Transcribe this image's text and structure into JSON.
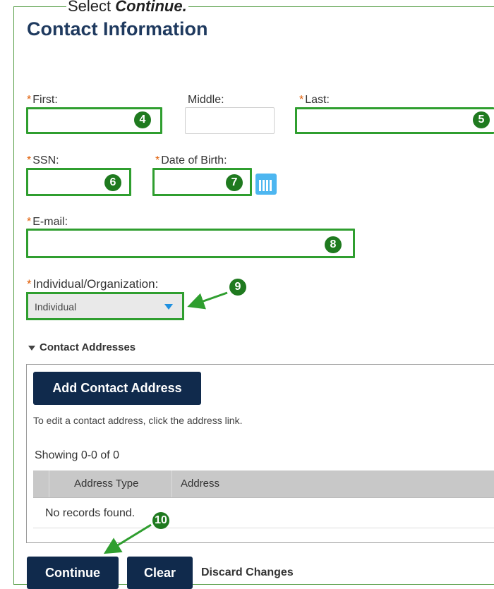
{
  "instruction": {
    "prefix": "Select ",
    "emphasis": "Continue."
  },
  "page_title": "Contact Information",
  "form": {
    "first": {
      "label": "First:",
      "required": "*",
      "value": "",
      "step": "4"
    },
    "middle": {
      "label": "Middle:",
      "value": ""
    },
    "last": {
      "label": "Last:",
      "required": "*",
      "value": "",
      "step": "5"
    },
    "ssn": {
      "label": "SSN:",
      "required": "*",
      "value": "",
      "step": "6"
    },
    "dob": {
      "label": "Date of Birth:",
      "required": "*",
      "value": "",
      "step": "7"
    },
    "email": {
      "label": "E-mail:",
      "required": "*",
      "value": "",
      "step": "8"
    },
    "type": {
      "label": "Individual/Organization:",
      "required": "*",
      "selected": "Individual",
      "step": "9"
    }
  },
  "addresses": {
    "section_title": "Contact Addresses",
    "add_button": "Add Contact Address",
    "hint": "To edit a contact address, click the address link.",
    "showing": "Showing 0-0 of 0",
    "columns": [
      "Address Type",
      "Address"
    ],
    "empty_text": "No records found."
  },
  "actions": {
    "continue": "Continue",
    "clear": "Clear",
    "discard": "Discard Changes",
    "step": "10"
  },
  "colors": {
    "highlight": "#2f9e2f",
    "badge": "#1f7a1f",
    "primary": "#102a4c",
    "required": "#e05a00"
  }
}
